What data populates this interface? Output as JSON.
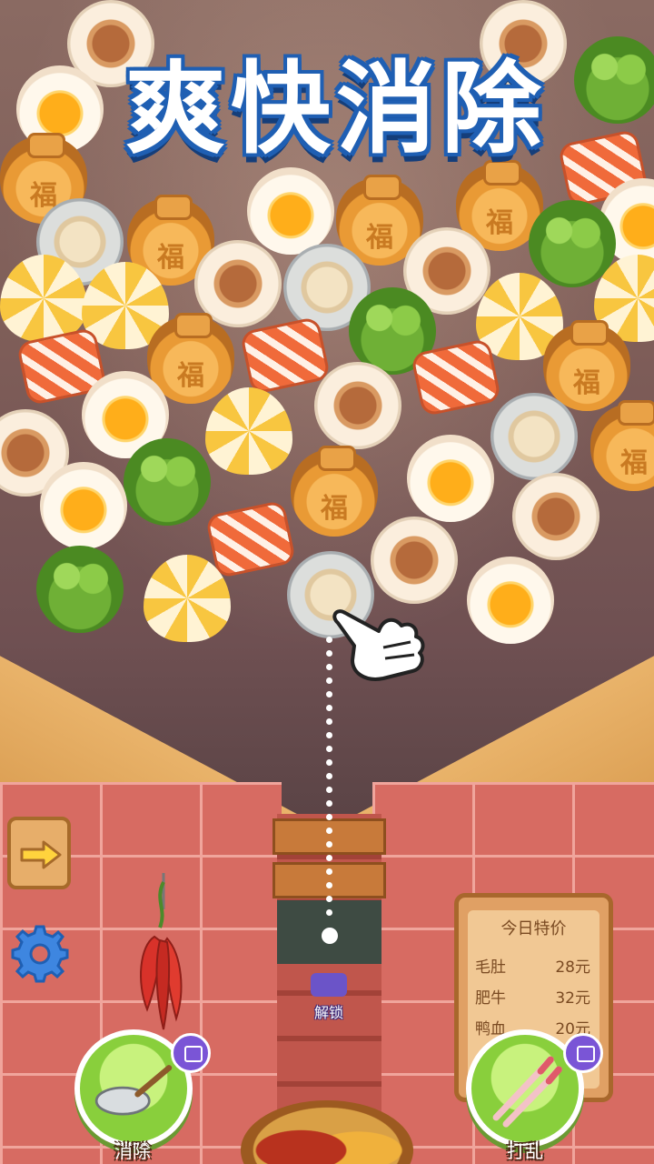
{
  "game": {
    "title": "爽快消除",
    "unlock_label": "解锁",
    "menu": {
      "title": "今日特价",
      "items": [
        {
          "name": "毛肚",
          "price": "28元"
        },
        {
          "name": "肥牛",
          "price": "32元"
        },
        {
          "name": "鸭血",
          "price": "20元"
        }
      ]
    },
    "tools": {
      "left_label": "消除",
      "right_label": "打乱"
    },
    "icons": {
      "arrow": "arrow-right-icon",
      "settings": "gear-icon",
      "video": "video-play-icon",
      "hand": "pointing-hand-icon"
    },
    "colors": {
      "title_fill": "#ffffff",
      "title_outline": "#1f5fb3",
      "tool_green": "#89cf3c",
      "video_purple": "#7a55d6"
    }
  }
}
